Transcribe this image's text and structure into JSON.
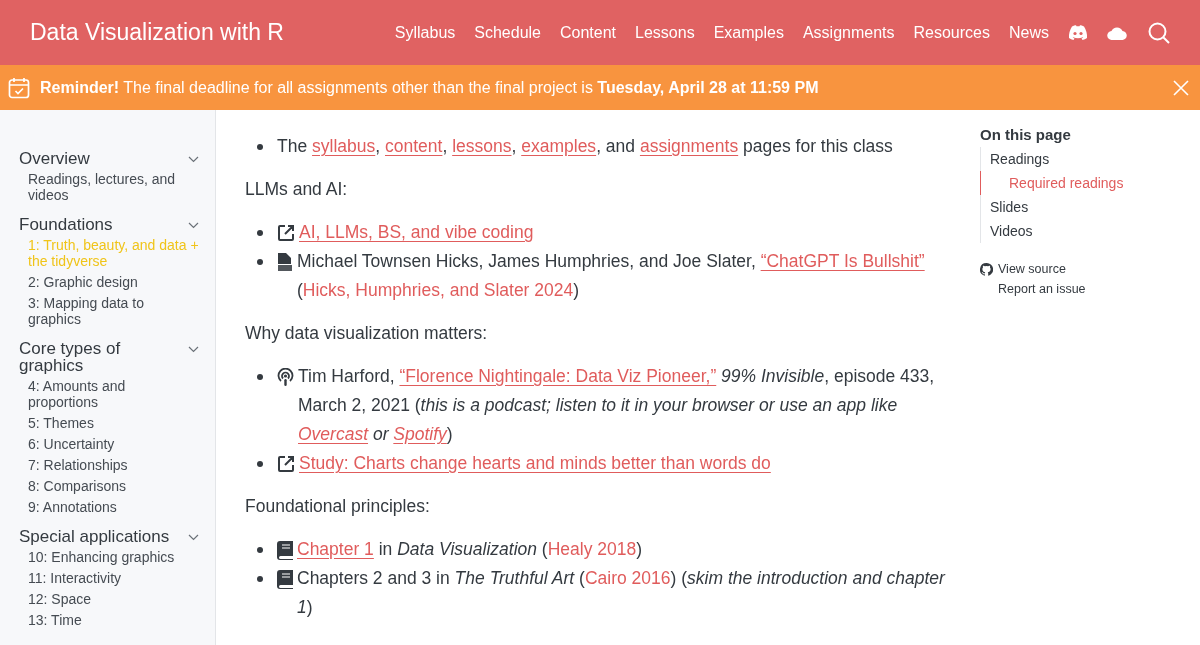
{
  "header": {
    "title": "Data Visualization with R",
    "nav": [
      "Syllabus",
      "Schedule",
      "Content",
      "Lessons",
      "Examples",
      "Assignments",
      "Resources",
      "News"
    ]
  },
  "banner": {
    "text": "**Reminder!** The final deadline for all assignments other than the final project is **Tuesday, April 28 at 11:59 PM**"
  },
  "sidebar": {
    "sections": [
      {
        "title": "Overview",
        "items": [
          {
            "label": "Readings, lectures, and videos",
            "selected": false
          }
        ]
      },
      {
        "title": "Foundations",
        "items": [
          {
            "label": "1: Truth, beauty, and data + the tidyverse",
            "selected": true
          },
          {
            "label": "2: Graphic design",
            "selected": false
          },
          {
            "label": "3: Mapping data to graphics",
            "selected": false
          }
        ]
      },
      {
        "title": "Core types of graphics",
        "items": [
          {
            "label": "4: Amounts and proportions",
            "selected": false
          },
          {
            "label": "5: Themes",
            "selected": false
          },
          {
            "label": "6: Uncertainty",
            "selected": false
          },
          {
            "label": "7: Relationships",
            "selected": false
          },
          {
            "label": "8: Comparisons",
            "selected": false
          },
          {
            "label": "9: Annotations",
            "selected": false
          }
        ]
      },
      {
        "title": "Special applications",
        "items": [
          {
            "label": "10: Enhancing graphics",
            "selected": false
          },
          {
            "label": "11: Interactivity",
            "selected": false
          },
          {
            "label": "12: Space",
            "selected": false
          },
          {
            "label": "13: Time",
            "selected": false
          }
        ]
      }
    ]
  },
  "content": [
    {
      "kind": "list",
      "items": [
        {
          "kind": "plain",
          "segments": [
            {
              "kind": "text",
              "text": "The "
            },
            {
              "kind": "link",
              "text": "syllabus"
            },
            {
              "kind": "text",
              "text": ", "
            },
            {
              "kind": "link",
              "text": "content"
            },
            {
              "kind": "text",
              "text": ", "
            },
            {
              "kind": "link",
              "text": "lessons"
            },
            {
              "kind": "text",
              "text": ", "
            },
            {
              "kind": "link",
              "text": "examples"
            },
            {
              "kind": "text",
              "text": ", and "
            },
            {
              "kind": "link",
              "text": "assignments"
            },
            {
              "kind": "text",
              "text": " pages for this class"
            }
          ]
        }
      ]
    },
    {
      "kind": "heading",
      "text": "LLMs and AI:"
    },
    {
      "kind": "list",
      "items": [
        {
          "kind": "web",
          "segments": [
            {
              "kind": "link",
              "text": "AI, LLMs, BS, and vibe coding"
            }
          ]
        },
        {
          "kind": "pdf",
          "segments": [
            {
              "kind": "text",
              "text": "Michael Townsen Hicks, James Humphries, and Joe Slater, "
            },
            {
              "kind": "link",
              "text": "“ChatGPT Is Bullshit”"
            },
            {
              "kind": "text",
              "text": " ("
            },
            {
              "kind": "cite",
              "text": "Hicks, Humphries, and Slater 2024"
            },
            {
              "kind": "text",
              "text": ")"
            }
          ]
        }
      ]
    },
    {
      "kind": "heading",
      "text": "Why data visualization matters:"
    },
    {
      "kind": "list",
      "items": [
        {
          "kind": "podcast",
          "segments": [
            {
              "kind": "text",
              "text": "Tim Harford, "
            },
            {
              "kind": "link",
              "text": "“Florence Nightingale: Data Viz Pioneer,”"
            },
            {
              "kind": "em",
              "text": " 99% Invisible"
            },
            {
              "kind": "text",
              "text": ", episode 433, March 2, 2021 ("
            },
            {
              "kind": "em",
              "text": "this is a podcast; listen to it in your browser or use an app like "
            },
            {
              "kind": "em-link",
              "text": "Overcast"
            },
            {
              "kind": "em",
              "text": " or "
            },
            {
              "kind": "em-link",
              "text": "Spotify"
            },
            {
              "kind": "text",
              "text": ")"
            }
          ]
        },
        {
          "kind": "web",
          "segments": [
            {
              "kind": "link",
              "text": "Study: Charts change hearts and minds better than words do"
            }
          ]
        }
      ]
    },
    {
      "kind": "heading",
      "text": "Foundational principles:"
    },
    {
      "kind": "list",
      "items": [
        {
          "kind": "book",
          "segments": [
            {
              "kind": "link",
              "text": "Chapter 1"
            },
            {
              "kind": "text",
              "text": " in "
            },
            {
              "kind": "em",
              "text": "Data Visualization"
            },
            {
              "kind": "text",
              "text": " ("
            },
            {
              "kind": "cite",
              "text": "Healy 2018"
            },
            {
              "kind": "text",
              "text": ")"
            }
          ]
        },
        {
          "kind": "book",
          "segments": [
            {
              "kind": "text",
              "text": "Chapters 2 and 3 in "
            },
            {
              "kind": "em",
              "text": "The Truthful Art"
            },
            {
              "kind": "text",
              "text": " ("
            },
            {
              "kind": "cite",
              "text": "Cairo 2016"
            },
            {
              "kind": "text",
              "text": ") ("
            },
            {
              "kind": "em",
              "text": "skim the introduction and chapter 1"
            },
            {
              "kind": "text",
              "text": ")"
            }
          ]
        }
      ]
    }
  ],
  "toc": {
    "title": "On this page",
    "items": [
      {
        "label": "Readings",
        "selected": false,
        "children": [
          {
            "label": "Required readings",
            "selected": true
          }
        ]
      },
      {
        "label": "Slides",
        "selected": false
      },
      {
        "label": "Videos",
        "selected": false
      }
    ],
    "links": [
      {
        "kind": "source",
        "label": "View source"
      },
      {
        "kind": "issue",
        "label": "Report an issue"
      }
    ]
  }
}
